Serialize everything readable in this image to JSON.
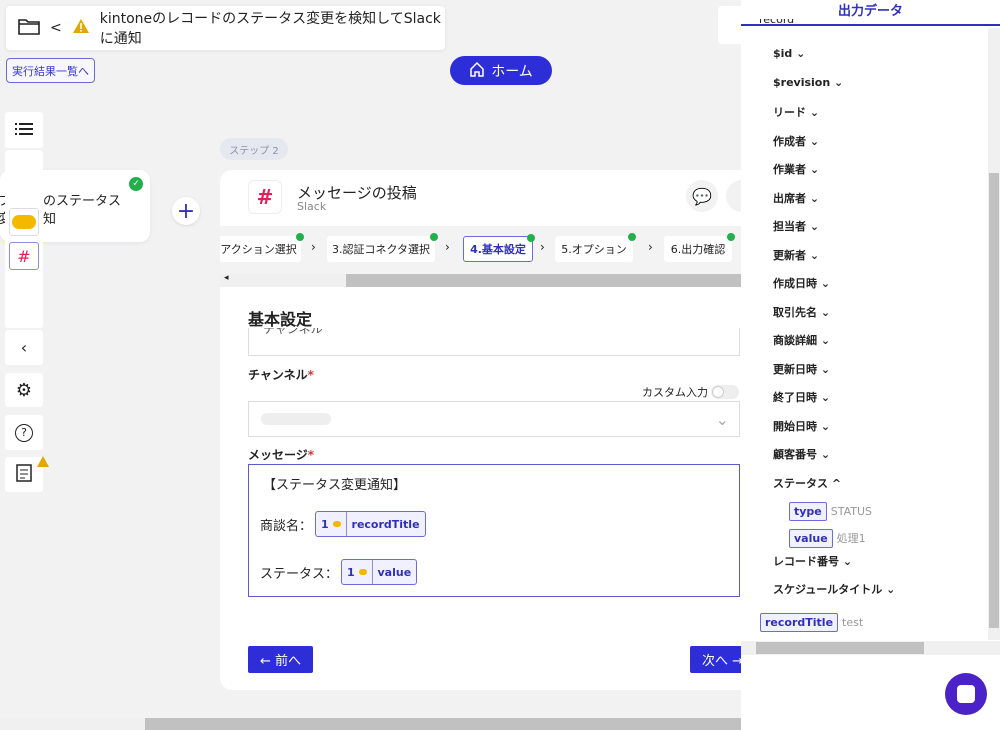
{
  "header": {
    "title": "kintoneのレコードのステータス変更を検知してSlackに通知",
    "runs_link": "実行結果一覧へ",
    "home": "ホーム"
  },
  "prev_step": {
    "line1": "のステータス",
    "line2": "知",
    "left1": "ブ",
    "left2": "変"
  },
  "step": {
    "pill": "ステップ 2",
    "title": "メッセージの投稿",
    "app": "Slack",
    "tabs": [
      {
        "label": "アクション選択"
      },
      {
        "label": "3.認証コネクタ選択"
      },
      {
        "label": "4.基本設定",
        "active": true
      },
      {
        "label": "5.オプション"
      },
      {
        "label": "6.出力確認"
      }
    ]
  },
  "form": {
    "section": "基本設定",
    "cut_field": "チャンネル",
    "channel_label": "チャンネル",
    "required": "*",
    "custom_input": "カスタム入力",
    "custom_input_on": false,
    "message_label": "メッセージ",
    "message": {
      "line1": "【ステータス変更通知】",
      "line2_prefix": "商談名：",
      "chip1_num": "1",
      "chip1_label": "recordTitle",
      "line3_prefix": "ステータス：",
      "chip2_num": "1",
      "chip2_label": "value"
    },
    "prev": "← 前へ",
    "next": "次へ →"
  },
  "panel": {
    "title": "出力データ",
    "root": "record",
    "items": [
      "$id",
      "$revision",
      "リード",
      "作成者",
      "作業者",
      "出席者",
      "担当者",
      "更新者",
      "作成日時",
      "取引先名",
      "商談詳細",
      "更新日時",
      "終了日時",
      "開始日時",
      "顧客番号"
    ],
    "status": {
      "label": "ステータス",
      "type_key": "type",
      "type_val": "STATUS",
      "value_key": "value",
      "value_val": "処理1"
    },
    "after": [
      "レコード番号",
      "スケジュールタイトル"
    ],
    "record_title": {
      "key": "recordTitle",
      "val": "test"
    }
  },
  "colors": {
    "accent": "#2e2ed8",
    "success": "#22b04b",
    "warning": "#e0a800"
  }
}
